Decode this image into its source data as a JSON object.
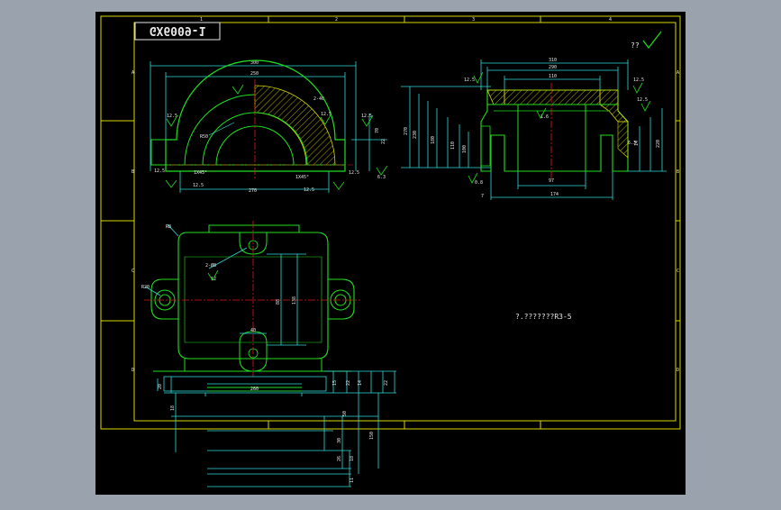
{
  "viewer": {
    "background_color": "#9aa3ad",
    "sheet_color": "#000000"
  },
  "colors": {
    "frame": "#d8d800",
    "outline": "#20e020",
    "centerline": "#e01818",
    "dimension": "#30d8d8",
    "hatch": "#d8d800",
    "text": "#e8e8e8",
    "mark": "#20e020"
  },
  "title_box": {
    "drawing_number": "GX6009-1"
  },
  "top_markers": [
    "1",
    "2",
    "3",
    "4"
  ],
  "side_markers": [
    "A",
    "B",
    "C",
    "D"
  ],
  "check_mark": "??",
  "front_view": {
    "dim_overall": "300",
    "dim_inner": "250",
    "dim_bottom": "270",
    "radius_label": "R50",
    "chamfer_left": "1X45°",
    "chamfer_right": "1X45°",
    "roughness_labels": [
      "12.5",
      "12.5",
      "12.5",
      "12.5",
      "12.5",
      "6.3",
      "12.5",
      "12.5"
    ],
    "height_label": "2-40",
    "width_label": "22",
    "depth_label": "70"
  },
  "section_view": {
    "dim_top_1": "310",
    "dim_top_2": "290",
    "dim_top_3": "110",
    "dim_bottom": "174",
    "dim_base": "97",
    "side_dims": [
      "270",
      "230",
      "180",
      "110",
      "100"
    ],
    "right_dims": [
      "14",
      "220",
      "6.3"
    ],
    "roughness_labels": [
      "12.5",
      "12.5",
      "1.6",
      "12.5"
    ],
    "small_dims": [
      "0.8",
      "7"
    ]
  },
  "plan_view": {
    "hole_label": "2-Ø8",
    "hole_depth": "12",
    "corner_radius": "R8",
    "slot_radius": "R20",
    "dim_vertical_1": "88",
    "dim_vertical_2": "138",
    "dim_small": "40"
  },
  "bottom_dims": {
    "left_stack": [
      "20",
      "18"
    ],
    "base_width": "260",
    "right_stack": [
      "15",
      "22",
      "14",
      "22"
    ],
    "column_labels": [
      "50",
      "30",
      "26",
      "18",
      "11"
    ],
    "tall_label": "150"
  },
  "note_text": "?.???????R3-5"
}
